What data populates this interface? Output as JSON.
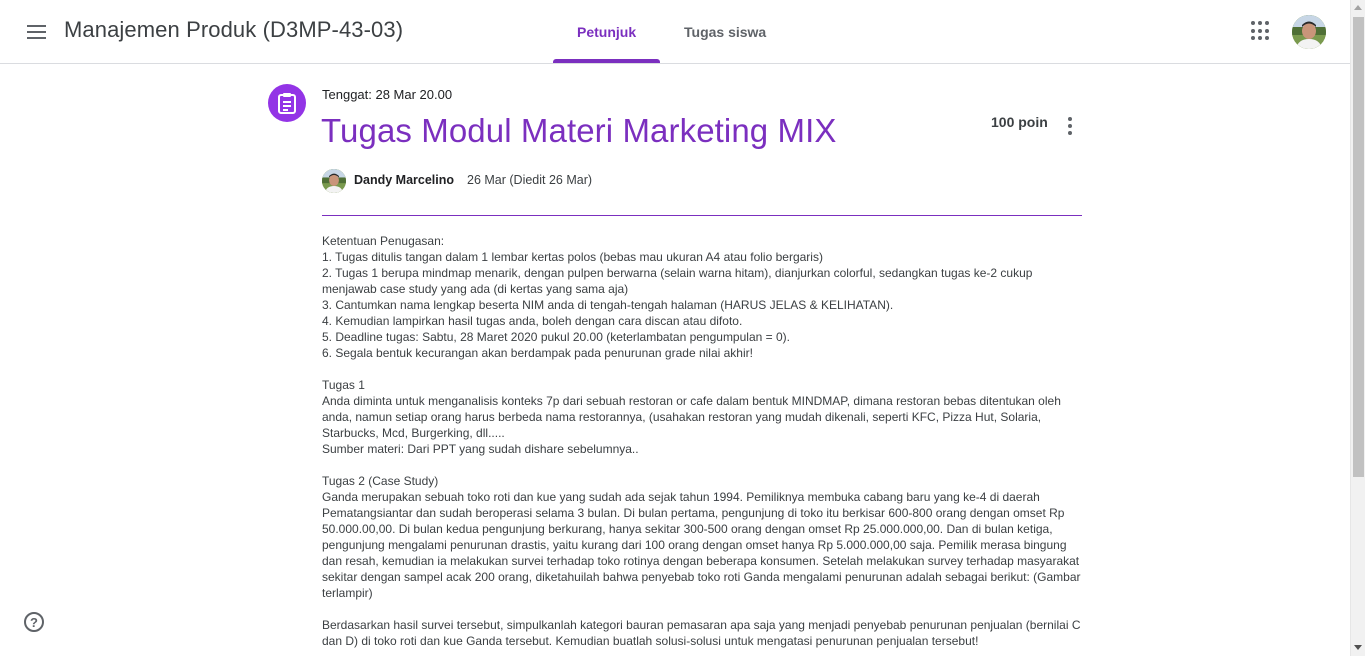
{
  "header": {
    "class_title": "Manajemen Produk (D3MP-43-03)",
    "tabs": [
      {
        "label": "Petunjuk",
        "active": true
      },
      {
        "label": "Tugas siswa",
        "active": false
      }
    ],
    "accent_color": "#7b2fbf"
  },
  "assignment": {
    "due": "Tenggat: 28 Mar 20.00",
    "title": "Tugas Modul Materi Marketing MIX",
    "points": "100 poin",
    "author": "Dandy Marcelino",
    "date": "26 Mar (Diedit 26 Mar)",
    "body": [
      "Ketentuan Penugasan:",
      "1. Tugas ditulis tangan dalam 1 lembar kertas polos (bebas mau ukuran A4 atau folio bergaris)",
      "2. Tugas 1 berupa mindmap menarik, dengan pulpen berwarna (selain warna hitam), dianjurkan colorful, sedangkan tugas ke-2 cukup menjawab case study yang ada (di kertas yang sama aja)",
      "3. Cantumkan nama lengkap beserta NIM anda di tengah-tengah halaman (HARUS JELAS & KELIHATAN).",
      "4. Kemudian lampirkan hasil tugas anda, boleh dengan cara discan atau difoto.",
      "5. Deadline tugas: Sabtu, 28 Maret 2020 pukul 20.00 (keterlambatan pengumpulan = 0).",
      "6. Segala bentuk kecurangan akan berdampak pada penurunan grade nilai akhir!",
      "",
      "Tugas 1",
      "Anda diminta untuk menganalisis konteks 7p dari sebuah restoran or cafe dalam bentuk MINDMAP, dimana restoran bebas ditentukan oleh anda, namun setiap orang harus berbeda nama restorannya, (usahakan restoran yang mudah dikenali, seperti KFC, Pizza Hut, Solaria, Starbucks, Mcd, Burgerking, dll.....",
      "Sumber materi: Dari PPT yang sudah dishare sebelumnya..",
      "",
      "Tugas 2 (Case Study)",
      "Ganda merupakan sebuah toko roti dan kue yang sudah ada sejak tahun 1994. Pemiliknya membuka cabang baru yang ke-4 di daerah Pematangsiantar dan sudah beroperasi selama 3 bulan. Di bulan pertama, pengunjung di toko itu berkisar 600-800 orang dengan omset Rp 50.000.00,00. Di bulan kedua pengunjung berkurang, hanya sekitar 300-500 orang dengan omset Rp 25.000.000,00. Dan di bulan ketiga, pengunjung mengalami penurunan drastis, yaitu kurang dari 100 orang dengan omset hanya Rp 5.000.000,00 saja. Pemilik merasa bingung dan resah, kemudian ia melakukan survei terhadap toko rotinya dengan beberapa konsumen. Setelah melakukan survey terhadap masyarakat sekitar dengan sampel acak 200 orang, diketahuilah bahwa penyebab toko roti Ganda mengalami penurunan adalah sebagai berikut: (Gambar terlampir)",
      "",
      "Berdasarkan hasil survei tersebut, simpulkanlah kategori bauran pemasaran apa saja yang menjadi penyebab penurunan penjualan (bernilai C dan D) di toko roti dan kue Ganda tersebut. Kemudian buatlah solusi-solusi untuk mengatasi penurunan penjualan tersebut!"
    ]
  },
  "help": {
    "label": "?"
  }
}
